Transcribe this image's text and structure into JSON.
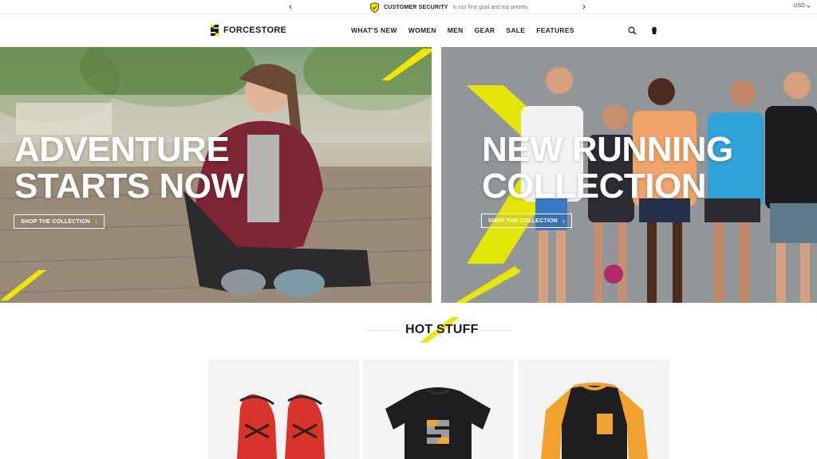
{
  "colors": {
    "accent": "#f2e600",
    "text": "#1a1a1a",
    "white": "#ffffff"
  },
  "topbar": {
    "prev_icon": "chevron-left-icon",
    "next_icon": "chevron-right-icon",
    "shield_icon": "shield-check-icon",
    "message_strong": "CUSTOMER SECURITY",
    "message_light": "is our first goal and top priority.",
    "currency": "USD"
  },
  "header": {
    "logo_text": "FORCESTORE",
    "nav": [
      "WHAT'S NEW",
      "WOMEN",
      "MEN",
      "GEAR",
      "SALE",
      "FEATURES"
    ],
    "search_icon": "search-icon",
    "bag_icon": "shopping-bag-icon"
  },
  "hero": {
    "left": {
      "title_line1": "ADVENTURE",
      "title_line2": "STARTS NOW",
      "button": "SHOP THE COLLECTION"
    },
    "right": {
      "title_line1": "NEW RUNNING",
      "title_line2": "COLLECTION",
      "button": "SHOP THE COLLECTION"
    }
  },
  "hot_stuff": {
    "title": "HOT STUFF",
    "products": [
      {
        "image": "red-running-shoes"
      },
      {
        "image": "black-tshirt-with-logo"
      },
      {
        "image": "orange-black-raglan-shirt"
      }
    ]
  }
}
